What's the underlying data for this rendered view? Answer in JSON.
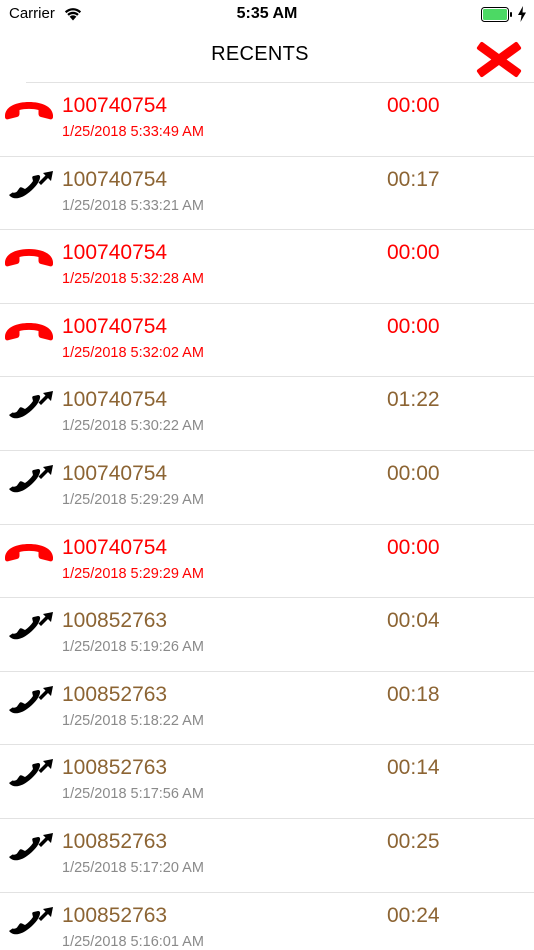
{
  "status_bar": {
    "carrier": "Carrier",
    "time": "5:35 AM"
  },
  "nav": {
    "title": "RECENTS",
    "close_icon": "close-x-icon"
  },
  "colors": {
    "missed": "#ff0000",
    "answered_text": "#8c6433",
    "answered_timestamp": "#8a8a8a",
    "battery": "#4cd964"
  },
  "calls": [
    {
      "type": "missed",
      "number": "100740754",
      "timestamp": "1/25/2018 5:33:49 AM",
      "duration": "00:00"
    },
    {
      "type": "answered",
      "number": "100740754",
      "timestamp": "1/25/2018 5:33:21 AM",
      "duration": "00:17"
    },
    {
      "type": "missed",
      "number": "100740754",
      "timestamp": "1/25/2018 5:32:28 AM",
      "duration": "00:00"
    },
    {
      "type": "missed",
      "number": "100740754",
      "timestamp": "1/25/2018 5:32:02 AM",
      "duration": "00:00"
    },
    {
      "type": "answered",
      "number": "100740754",
      "timestamp": "1/25/2018 5:30:22 AM",
      "duration": "01:22"
    },
    {
      "type": "answered",
      "number": "100740754",
      "timestamp": "1/25/2018 5:29:29 AM",
      "duration": "00:00"
    },
    {
      "type": "missed",
      "number": "100740754",
      "timestamp": "1/25/2018 5:29:29 AM",
      "duration": "00:00"
    },
    {
      "type": "answered",
      "number": "100852763",
      "timestamp": "1/25/2018 5:19:26 AM",
      "duration": "00:04"
    },
    {
      "type": "answered",
      "number": "100852763",
      "timestamp": "1/25/2018 5:18:22 AM",
      "duration": "00:18"
    },
    {
      "type": "answered",
      "number": "100852763",
      "timestamp": "1/25/2018 5:17:56 AM",
      "duration": "00:14"
    },
    {
      "type": "answered",
      "number": "100852763",
      "timestamp": "1/25/2018 5:17:20 AM",
      "duration": "00:25"
    },
    {
      "type": "answered",
      "number": "100852763",
      "timestamp": "1/25/2018 5:16:01 AM",
      "duration": "00:24"
    }
  ]
}
